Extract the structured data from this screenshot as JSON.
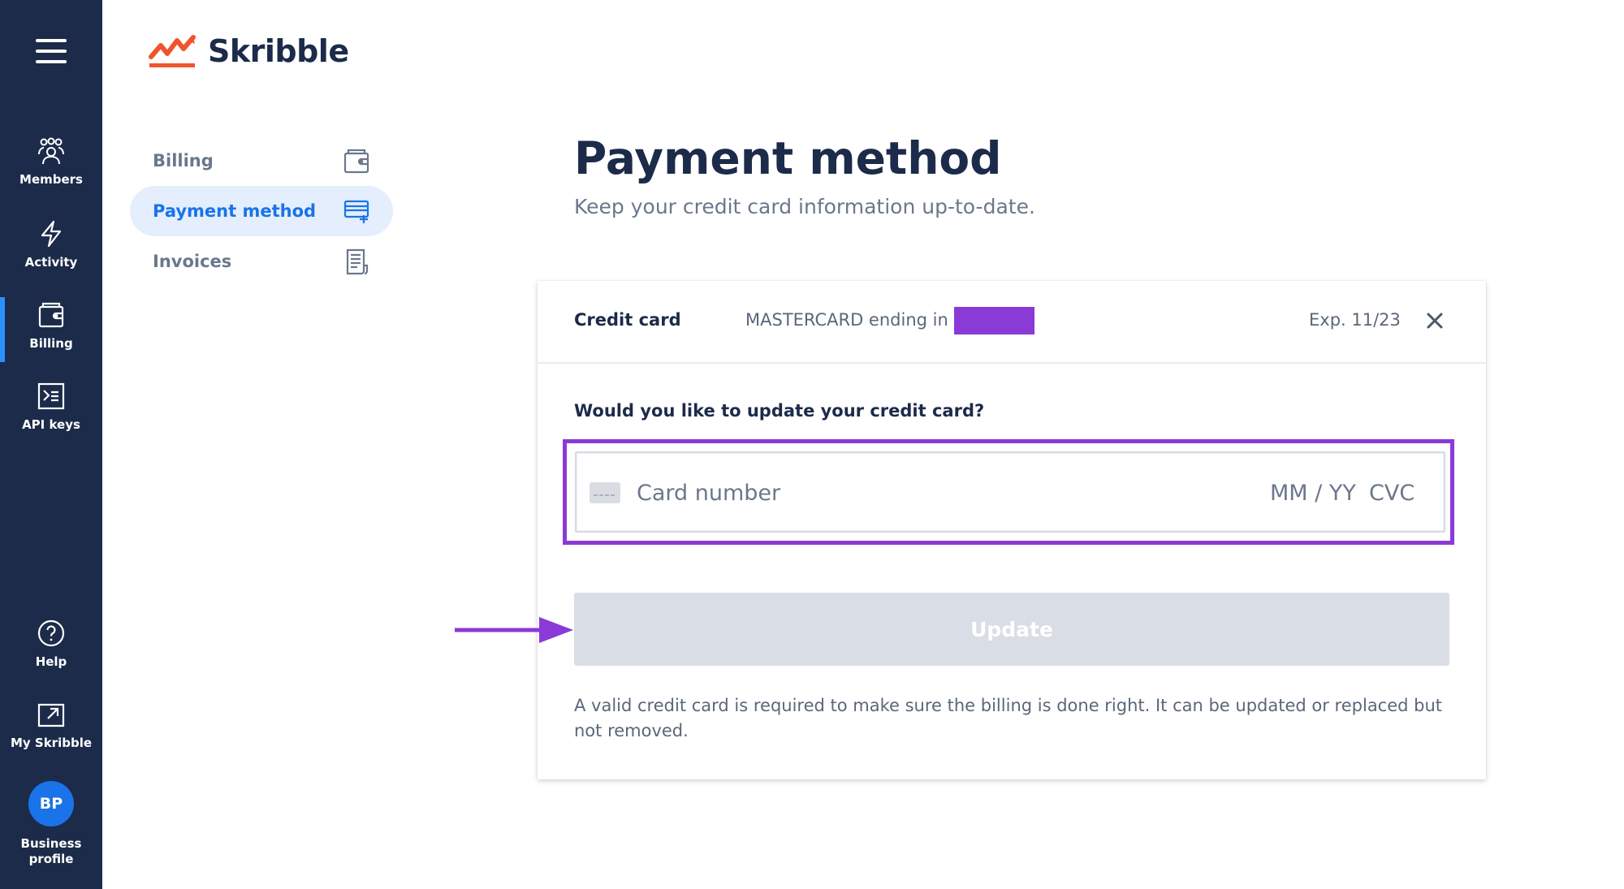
{
  "brand": {
    "name": "Skribble",
    "accent": "#f0542d"
  },
  "rail": {
    "items": [
      {
        "label": "Members",
        "icon": "members-icon"
      },
      {
        "label": "Activity",
        "icon": "activity-icon"
      },
      {
        "label": "Billing",
        "icon": "wallet-icon",
        "active": true
      },
      {
        "label": "API keys",
        "icon": "terminal-icon"
      },
      {
        "label": "Help",
        "icon": "help-icon"
      },
      {
        "label": "My Skribble",
        "icon": "external-link-icon"
      }
    ],
    "profile": {
      "initials": "BP",
      "label_line1": "Business",
      "label_line2": "profile"
    }
  },
  "subnav": {
    "items": [
      {
        "label": "Billing",
        "icon": "wallet-icon"
      },
      {
        "label": "Payment method",
        "icon": "credit-card-add-icon",
        "active": true
      },
      {
        "label": "Invoices",
        "icon": "invoice-icon"
      }
    ]
  },
  "page": {
    "title": "Payment method",
    "subtitle": "Keep your credit card information up-to-date."
  },
  "card": {
    "label": "Credit card",
    "description": "MASTERCARD ending in",
    "expiry": "Exp. 11/23",
    "question": "Would you like to update your credit card?",
    "input": {
      "card_number_placeholder": "Card number",
      "expiry_placeholder": "MM / YY",
      "cvc_placeholder": "CVC"
    },
    "update_label": "Update",
    "note": "A valid credit card is required to make sure the billing is done right. It can be updated or replaced but not removed."
  },
  "colors": {
    "rail_bg": "#1c2b4a",
    "active_indicator": "#2b8fff",
    "link_blue": "#1a73e8",
    "highlight_purple": "#8a3ad6",
    "disabled_button": "#d9dee6"
  }
}
